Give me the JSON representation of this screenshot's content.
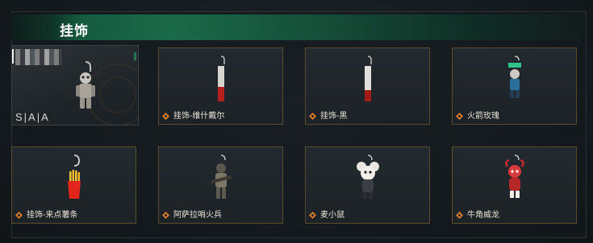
{
  "header": {
    "title": "挂饰"
  },
  "featured": {
    "tag": "S|A|A"
  },
  "cards": [
    {
      "label": "挂饰-维什戴尔"
    },
    {
      "label": "挂饰-黑"
    },
    {
      "label": "火箭玫瑰"
    },
    {
      "label": "挂饰-来点薯条"
    },
    {
      "label": "阿萨拉哨火兵"
    },
    {
      "label": "麦小鼠"
    },
    {
      "label": "牛角威龙"
    }
  ],
  "colors": {
    "header_green": "#1a6a49",
    "card_border": "#5a4b2f",
    "rarity_orange": "#d97a2b"
  }
}
